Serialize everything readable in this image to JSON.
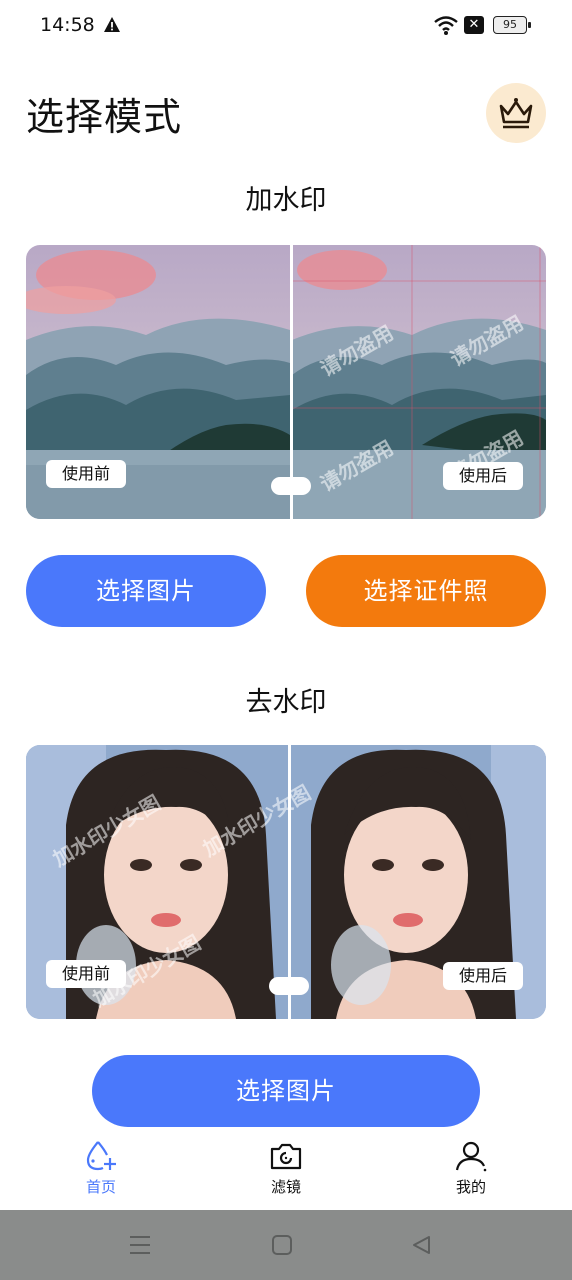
{
  "status_bar": {
    "time": "14:58",
    "battery": "95",
    "icons": [
      "warning-icon",
      "wifi-icon",
      "sim-off-icon",
      "battery-icon"
    ]
  },
  "header": {
    "title": "选择模式",
    "vip_icon": "crown-icon"
  },
  "add_watermark": {
    "title": "加水印",
    "before_label": "使用前",
    "after_label": "使用后",
    "watermark_text": "请勿盗用",
    "select_image_label": "选择图片",
    "select_id_photo_label": "选择证件照"
  },
  "remove_watermark": {
    "title": "去水印",
    "before_label": "使用前",
    "after_label": "使用后",
    "watermark_text": "加水印少女图",
    "select_image_label": "选择图片"
  },
  "bottom_nav": {
    "items": [
      {
        "label": "首页",
        "icon": "drop-plus-icon",
        "active": true
      },
      {
        "label": "滤镜",
        "icon": "camera-icon",
        "active": false
      },
      {
        "label": "我的",
        "icon": "user-icon",
        "active": false
      }
    ]
  },
  "system_nav": {
    "icons": [
      "menu-icon",
      "home-icon",
      "back-icon"
    ]
  },
  "colors": {
    "primary": "#4a78fb",
    "orange": "#f37a0d",
    "vip_bg": "#fbead0",
    "system_bar": "#8a8c8b"
  }
}
